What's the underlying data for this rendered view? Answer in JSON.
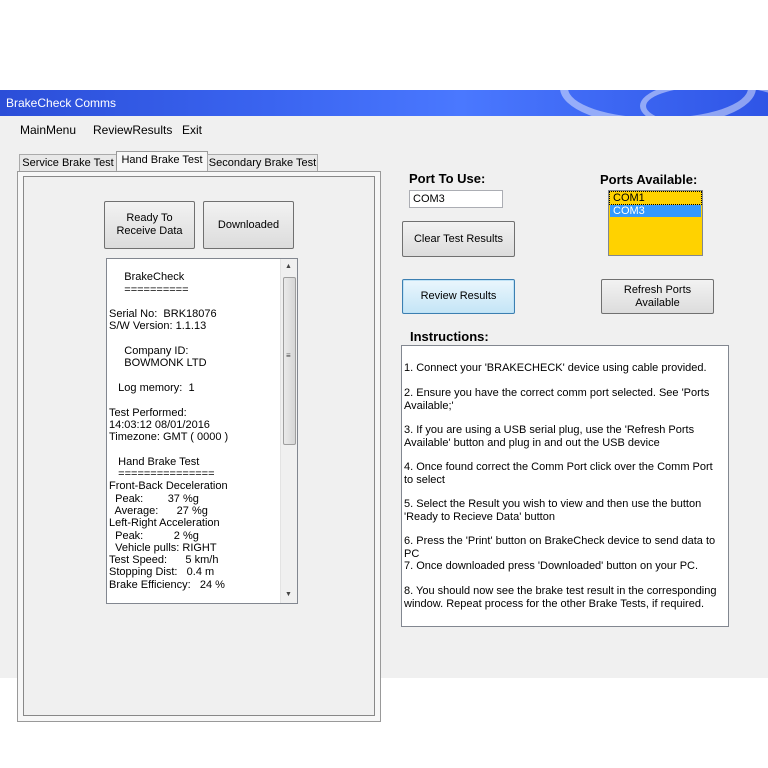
{
  "window": {
    "title": "BrakeCheck Comms"
  },
  "menu": [
    "MainMenu",
    "ReviewResults",
    "Exit"
  ],
  "tabs": [
    "Service Brake Test",
    "Hand Brake Test",
    "Secondary Brake Test"
  ],
  "buttons": {
    "ready_to_receive": "Ready To\nReceive Data",
    "downloaded": "Downloaded",
    "clear_test_results": "Clear Test Results",
    "review_results": "Review Results",
    "refresh_ports": "Refresh Ports\nAvailable"
  },
  "report_lines": [
    "",
    "     BrakeCheck",
    "     ==========",
    "",
    "Serial No:  BRK18076",
    "S/W Version: 1.1.13",
    "",
    "     Company ID:",
    "     BOWMONK LTD",
    "",
    "   Log memory:  1",
    "",
    "Test Performed:",
    "14:03:12 08/01/2016",
    "Timezone: GMT ( 0000 )",
    "",
    "   Hand Brake Test",
    "   ===============",
    "Front-Back Deceleration",
    "  Peak:        37 %g",
    "  Average:      27 %g",
    "Left-Right Acceleration",
    "  Peak:          2 %g",
    "  Vehicle pulls: RIGHT",
    "Test Speed:      5 km/h",
    "Stopping Dist:   0.4 m",
    "Brake Efficiency:   24 %"
  ],
  "port": {
    "label": "Port To Use:",
    "value": "COM3"
  },
  "ports_available": {
    "label": "Ports Available:",
    "items": [
      "COM1",
      "COM3"
    ],
    "selected": "COM3"
  },
  "instructions": {
    "label": "Instructions:",
    "lines": [
      "1. Connect your 'BRAKECHECK' device using cable provided.",
      "2. Ensure you have the correct comm port selected. See 'Ports Available;'",
      "3. If you are using a USB serial plug, use the 'Refresh Ports Available' button and plug in and out the USB device",
      "4. Once found correct the Comm Port click over the Comm Port to select",
      "5. Select the Result you wish to view and then use the button  'Ready to Recieve Data' button",
      "6. Press the 'Print' button on BrakeCheck device to send data to PC",
      "7. Once downloaded press 'Downloaded' button on your PC.",
      "8. You should now see the brake test result in the corresponding window. Repeat process for the other Brake Tests, if required."
    ]
  },
  "colors": {
    "titlebar": "#3a64f0",
    "listbox_bg": "#ffd200",
    "selection": "#3399ff"
  }
}
